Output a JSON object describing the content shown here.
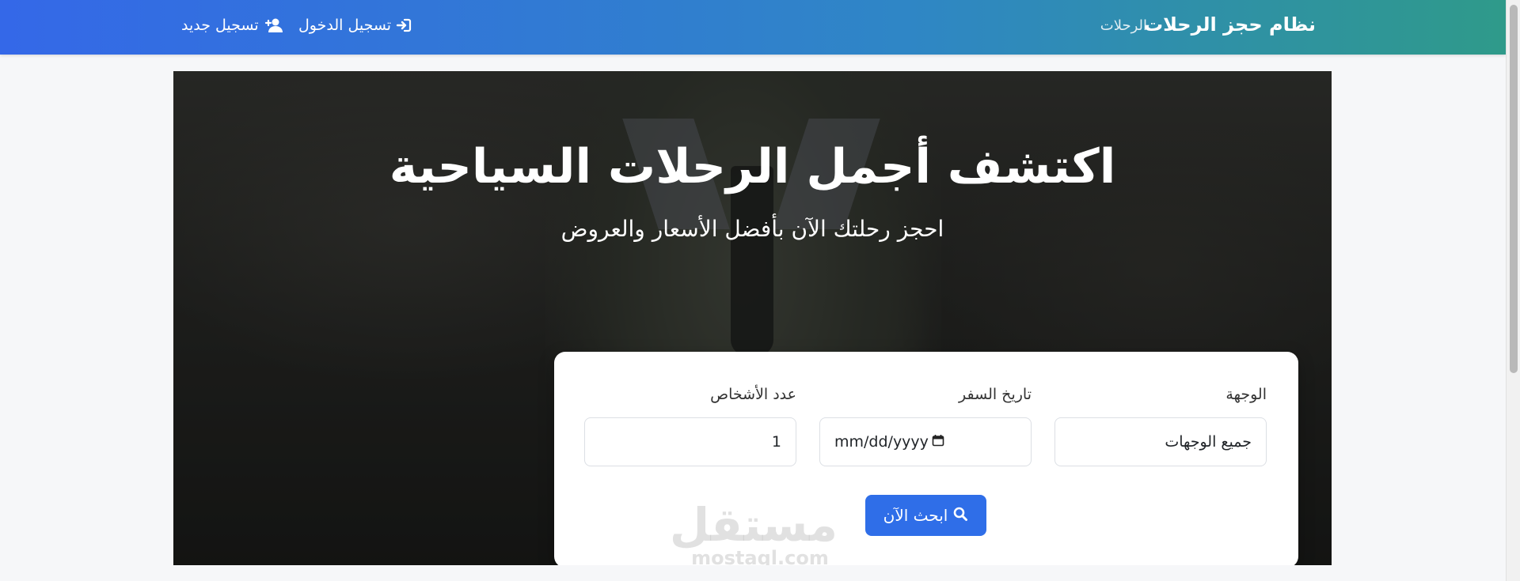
{
  "navbar": {
    "brand": "نظام حجز الرحلات",
    "trips_link": "الرحلات",
    "login_label": "تسجيل الدخول",
    "register_label": "تسجيل جديد",
    "gradient_colors": [
      "#3468e8",
      "#2f86c6",
      "#2f9a8a"
    ]
  },
  "hero": {
    "title": "اكتشف أجمل الرحلات السياحية",
    "subtitle": "احجز رحلتك الآن بأفضل الأسعار والعروض"
  },
  "search": {
    "destination_label": "الوجهة",
    "destination_value": "جميع الوجهات",
    "date_label": "تاريخ السفر",
    "date_placeholder": "mm/dd/yyyy",
    "people_label": "عدد الأشخاص",
    "people_value": "1",
    "button_label": "ابحث الآن",
    "button_color": "#2f6ee8"
  },
  "watermark": {
    "arabic": "مستقل",
    "latin": "mostaql.com"
  },
  "icons": {
    "login": "sign-in-icon",
    "register": "user-plus-icon",
    "search": "search-icon",
    "calendar": "calendar-icon"
  }
}
